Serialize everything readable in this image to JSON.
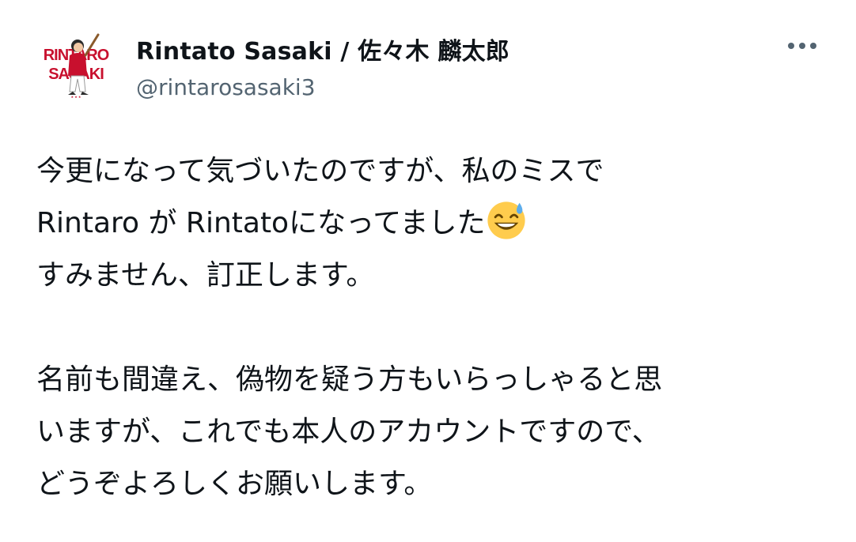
{
  "author": {
    "display_name": "Rintato Sasaki / 佐々木 麟太郎",
    "handle": "@rintarosasaki3",
    "avatar_text_top": "RINTARO",
    "avatar_text_bottom": "SASAKI",
    "avatar_icon": "baseball-player-illustration"
  },
  "menu": {
    "icon": "more-horizontal-icon"
  },
  "tweet": {
    "line1": "今更になって気づいたのですが、私のミスで",
    "line2": "Rintaro が Rintatoになってました",
    "line2_emoji": "grinning-face-with-sweat-emoji",
    "line3": "すみません、訂正します。",
    "line4": "名前も間違え、偽物を疑う方もいらっしゃると思",
    "line5": "いますが、これでも本人のアカウントですので、",
    "line6": "どうぞよろしくお願いします。"
  },
  "colors": {
    "text": "#0f1419",
    "secondary": "#536471",
    "avatar_red": "#c8102e",
    "emoji_yellow": "#ffcc4d",
    "emoji_sweat": "#5dadec"
  }
}
